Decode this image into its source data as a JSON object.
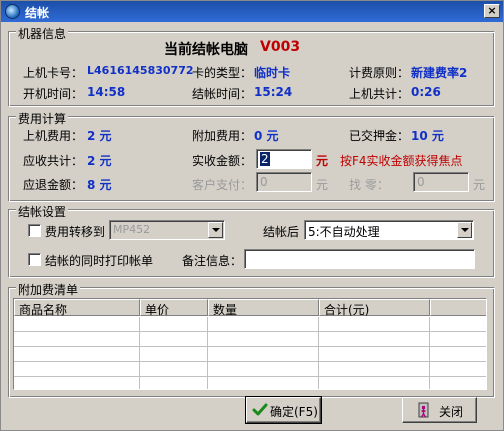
{
  "window": {
    "title": "结帐"
  },
  "machine": {
    "group_label": "机器信息",
    "current_label": "当前结帐电脑",
    "current_value": "V003",
    "card_no_label": "上机卡号：",
    "card_no": "L4616145830772",
    "card_type_label": "卡的类型：",
    "card_type": "临时卡",
    "billing_rule_label": "计费原则：",
    "billing_rule": "新建费率2",
    "start_time_label": "开机时间：",
    "start_time": "14:58",
    "checkout_time_label": "结帐时间：",
    "checkout_time": "15:24",
    "total_time_label": "上机共计：",
    "total_time": "0:26"
  },
  "fees": {
    "group_label": "费用计算",
    "online_fee_label": "上机费用：",
    "online_fee": "2 元",
    "extra_fee_label": "附加费用：",
    "extra_fee": "0 元",
    "deposit_label": "已交押金：",
    "deposit": "10 元",
    "receivable_label": "应收共计：",
    "receivable": "2 元",
    "actual_label": "实收金额：",
    "actual_value": "2",
    "actual_unit": "元",
    "f4_hint": "按F4实收金额获得焦点",
    "refund_label": "应退金额：",
    "refund": "8 元",
    "customer_pay_label": "客户支付：",
    "customer_pay_value": "0",
    "customer_pay_unit": "元",
    "change_label": "找    零：",
    "change_value": "0",
    "change_unit": "元"
  },
  "settings": {
    "group_label": "结帐设置",
    "transfer_label": "费用转移到",
    "transfer_target": "MP452",
    "after_checkout_label": "结帐后",
    "after_checkout_value": "5:不自动处理",
    "print_label": "结帐的同时打印帐单",
    "remark_label": "备注信息：",
    "remark_value": ""
  },
  "extras": {
    "group_label": "附加费清单",
    "columns": [
      "商品名称",
      "单价",
      "数量",
      "合计(元)"
    ]
  },
  "buttons": {
    "ok": "确定(F5)",
    "close": "关闭"
  }
}
